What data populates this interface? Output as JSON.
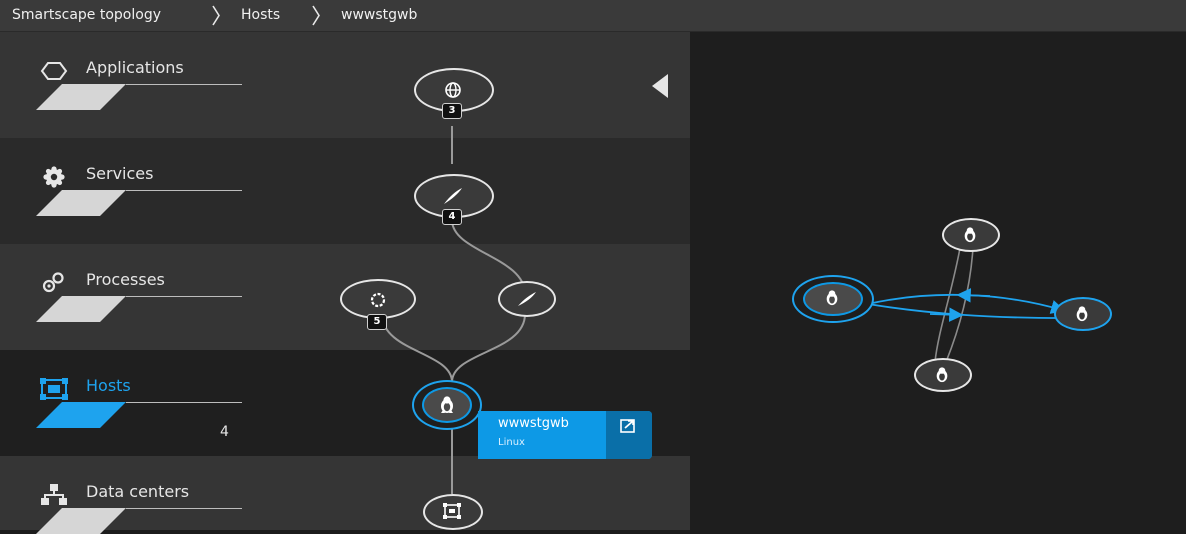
{
  "breadcrumb": {
    "items": [
      "Smartscape topology",
      "Hosts",
      "wwwstgwb"
    ]
  },
  "layers": [
    {
      "name": "Applications",
      "icon": "hexagon-icon",
      "count": ""
    },
    {
      "name": "Services",
      "icon": "gear-icon",
      "count": ""
    },
    {
      "name": "Processes",
      "icon": "process-icon",
      "count": ""
    },
    {
      "name": "Hosts",
      "icon": "host-icon",
      "count": "4"
    },
    {
      "name": "Data centers",
      "icon": "datacenter-icon",
      "count": ""
    }
  ],
  "vertical_nodes": {
    "applications_badge": "3",
    "services_badge": "4",
    "processes_badge": "5"
  },
  "host_card": {
    "title": "wwwstgwb",
    "subtitle": "Linux"
  },
  "colors": {
    "accent": "#0d99e6",
    "panel_dark": "#2a2a2a",
    "panel_light": "#353535"
  }
}
